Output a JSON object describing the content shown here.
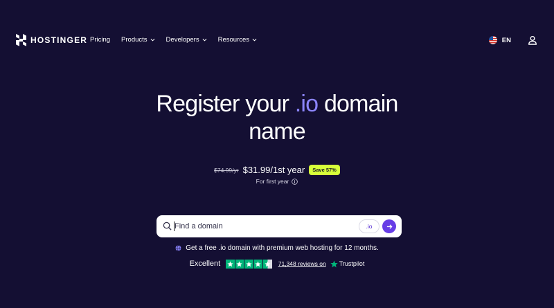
{
  "header": {
    "logo_text": "HOSTINGER",
    "nav": [
      {
        "label": "Pricing",
        "dropdown": false
      },
      {
        "label": "Products",
        "dropdown": true
      },
      {
        "label": "Developers",
        "dropdown": true
      },
      {
        "label": "Resources",
        "dropdown": true
      }
    ],
    "language": "EN",
    "icons": {
      "flag": "us-flag-icon",
      "account": "user-icon"
    }
  },
  "hero": {
    "title_before": "Register your ",
    "title_accent": ".io",
    "title_after_line1": " domain",
    "title_line2": "name",
    "accent_color": "#8c85ff"
  },
  "pricing": {
    "old_price": "$74.99/yr",
    "new_price": "$31.99/1st year",
    "save_badge": "Save 57%",
    "badge_color": "#d7ff3a",
    "note": "For first year"
  },
  "search": {
    "placeholder": "Find a domain",
    "value": "",
    "tld": ".io",
    "button_color": "#673de6"
  },
  "promo": {
    "text": "Get a free .io domain with premium web hosting for 12 months."
  },
  "trustpilot": {
    "rating_label": "Excellent",
    "stars": 4.5,
    "star_color": "#00b67a",
    "reviews_link": "71,348 reviews on",
    "brand": "Trustpilot"
  },
  "colors": {
    "background": "#140f33"
  }
}
